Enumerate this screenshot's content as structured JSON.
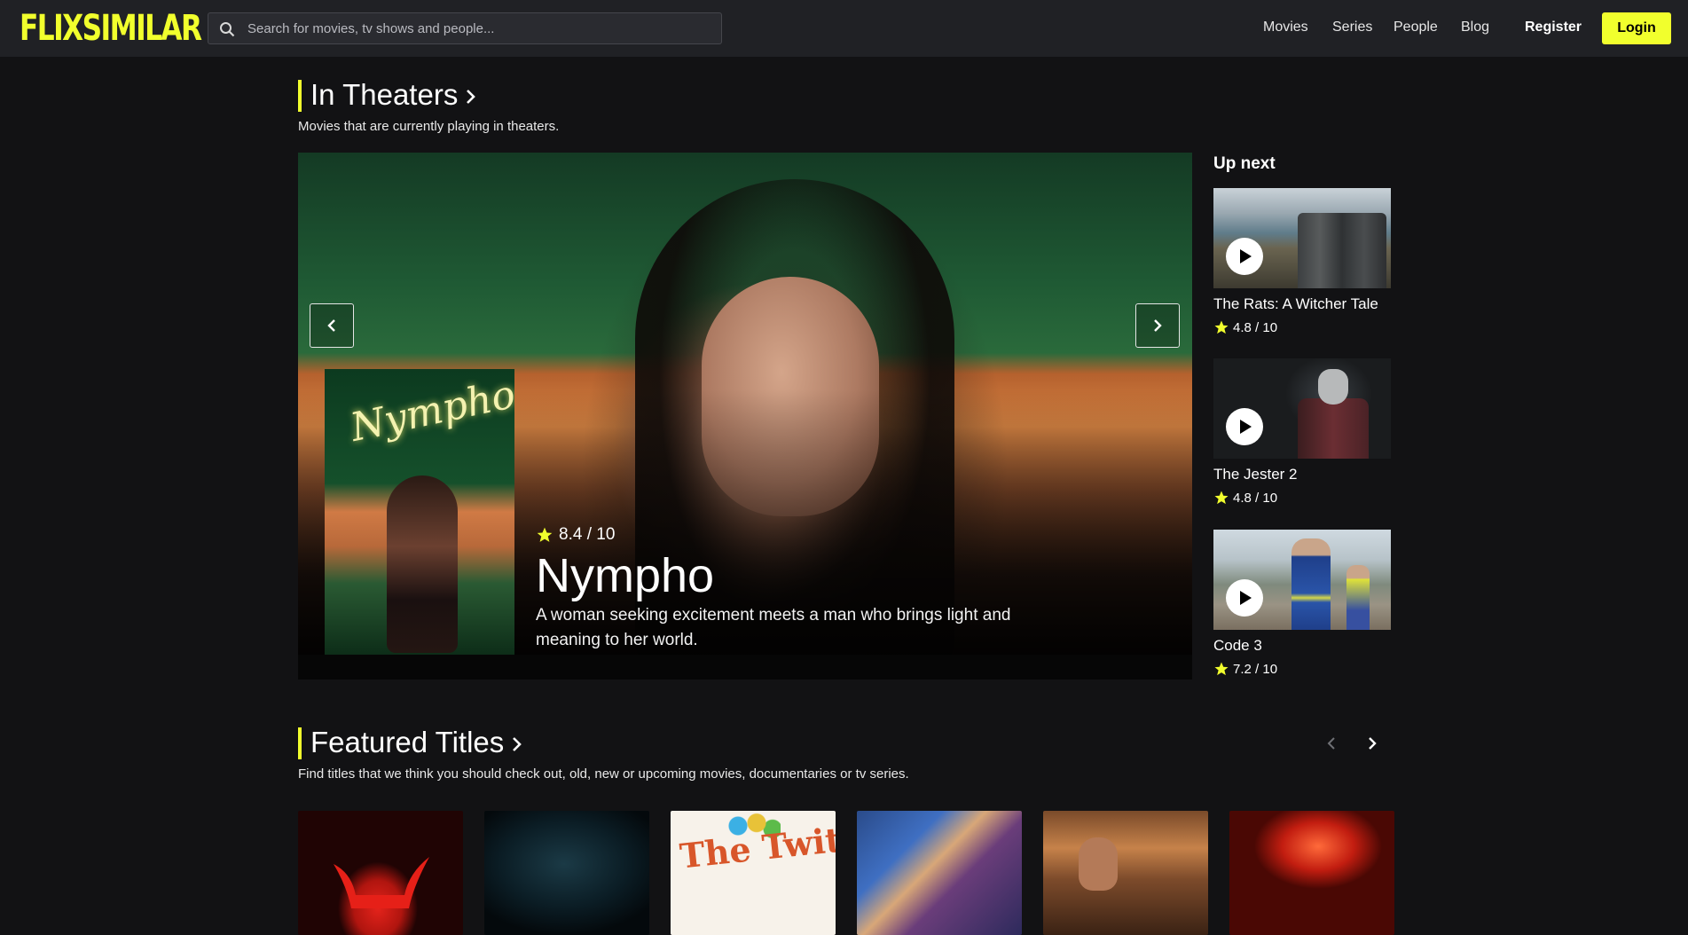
{
  "header": {
    "logo": "FLIXSIMILAR",
    "search_placeholder": "Search for movies, tv shows and people...",
    "nav": [
      "Movies",
      "Series",
      "People",
      "Blog"
    ],
    "register": "Register",
    "login": "Login"
  },
  "colors": {
    "accent": "#f1ff2d",
    "background": "#121214",
    "header": "#202125",
    "star": "#f1ff2d"
  },
  "in_theaters": {
    "title": "In Theaters",
    "subtitle": "Movies that are currently playing in theaters.",
    "featured": {
      "rating": "8.4 / 10",
      "title": "Nympho",
      "description": "A woman seeking excitement meets a man who brings light and meaning to her world.",
      "poster_text": "Nympho"
    }
  },
  "up_next": {
    "title": "Up next",
    "items": [
      {
        "name": "The Rats: A Witcher Tale",
        "rating": "4.8 / 10"
      },
      {
        "name": "The Jester 2",
        "rating": "4.8 / 10"
      },
      {
        "name": "Code 3",
        "rating": "7.2 / 10"
      }
    ]
  },
  "featured_titles": {
    "title": "Featured Titles",
    "subtitle": "Find titles that we think you should check out, old, new or upcoming movies, documentaries or tv series.",
    "poster_text_3": "The Twits"
  },
  "icons": {
    "search": "search-icon",
    "section_arrow": "chevron-right-icon",
    "hero_prev": "chevron-left-icon",
    "hero_next": "chevron-right-icon",
    "star": "star-icon",
    "play": "play-icon"
  }
}
